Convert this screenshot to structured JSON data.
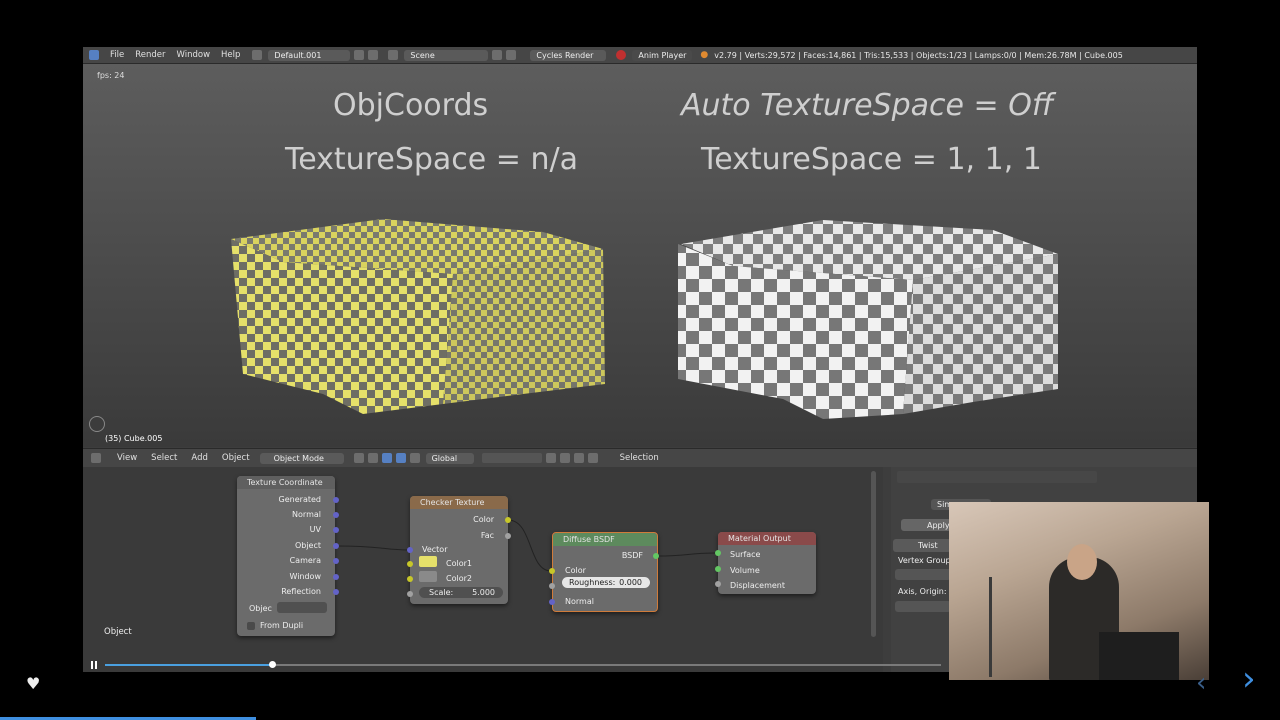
{
  "topbar": {
    "menus": [
      "File",
      "Render",
      "Window",
      "Help"
    ],
    "layout": "Default.001",
    "scene": "Scene",
    "engine": "Cycles Render",
    "anim_player": "Anim Player",
    "stats": "v2.79 | Verts:29,572 | Faces:14,861 | Tris:15,533 | Objects:1/23 | Lamps:0/0 | Mem:26.78M | Cube.005"
  },
  "viewport": {
    "fps": "fps: 24",
    "left_title": "ObjCoords",
    "left_sub": "TextureSpace = n/a",
    "right_title": "Auto TextureSpace = Off",
    "right_sub": "TextureSpace = 1, 1, 1",
    "object_label": "(35) Cube.005"
  },
  "node_header": {
    "menus": [
      "View",
      "Select",
      "Add",
      "Object"
    ],
    "mode": "Object Mode",
    "orientation": "Global",
    "selection": "Selection"
  },
  "nodes": {
    "texcoord": {
      "title": "Texture Coordinate",
      "outputs": [
        "Generated",
        "Normal",
        "UV",
        "Object",
        "Camera",
        "Window",
        "Reflection"
      ],
      "object_label": "Objec",
      "from_dupli": "From Dupli"
    },
    "checker": {
      "title": "Checker Texture",
      "outputs": [
        "Color",
        "Fac"
      ],
      "vector": "Vector",
      "color1": "Color1",
      "color2": "Color2",
      "scale": "Scale:",
      "scale_value": "5.000"
    },
    "diffuse": {
      "title": "Diffuse BSDF",
      "bsdf": "BSDF",
      "color": "Color",
      "roughness": "Roughness:",
      "roughness_value": "0.000",
      "normal": "Normal"
    },
    "output": {
      "title": "Material Output",
      "inputs": [
        "Surface",
        "Volume",
        "Displacement"
      ]
    },
    "footer_label": "Object"
  },
  "props": {
    "sim": "Sim",
    "apply": "Apply",
    "twist": "Twist",
    "vertex_group": "Vertex Group",
    "axis_origin": "Axis, Origin:"
  },
  "colors": {
    "accent": "#5680c2",
    "checker_yellow": "#e5e06a",
    "progress": "#4aa0e0"
  },
  "player": {
    "progress_fraction": 0.2
  }
}
